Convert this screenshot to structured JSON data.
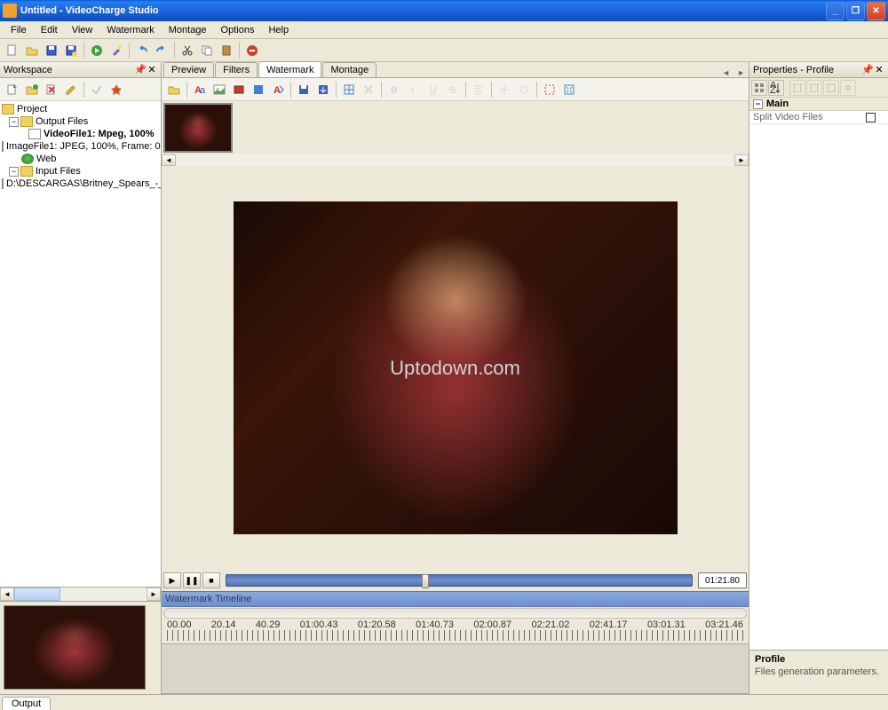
{
  "window": {
    "title": "Untitled - VideoCharge Studio"
  },
  "menu": {
    "file": "File",
    "edit": "Edit",
    "view": "View",
    "watermark": "Watermark",
    "montage": "Montage",
    "options": "Options",
    "help": "Help"
  },
  "workspace": {
    "title": "Workspace",
    "tree": {
      "root": "Project",
      "output": "Output Files",
      "video1": "VideoFile1: Mpeg, 100%",
      "image1": "ImageFile1: JPEG, 100%, Frame: 0",
      "web": "Web",
      "input": "Input Files",
      "file1": "D:\\DESCARGAS\\Britney_Spears_-_"
    }
  },
  "centerTabs": {
    "preview": "Preview",
    "filters": "Filters",
    "watermark": "Watermark",
    "montage": "Montage"
  },
  "preview": {
    "watermark": "Uptodown.com",
    "time": "01:21.80"
  },
  "timeline": {
    "title": "Watermark Timeline",
    "ticks": [
      "00.00",
      "20.14",
      "40.29",
      "01:00.43",
      "01:20.58",
      "01:40.73",
      "02:00.87",
      "02:21.02",
      "02:41.17",
      "03:01.31",
      "03:21.46"
    ]
  },
  "props": {
    "title": "Properties - Profile",
    "cat": "Main",
    "row1": "Split Video Files",
    "help_title": "Profile",
    "help_desc": "Files generation parameters."
  },
  "status": {
    "output": "Output"
  }
}
